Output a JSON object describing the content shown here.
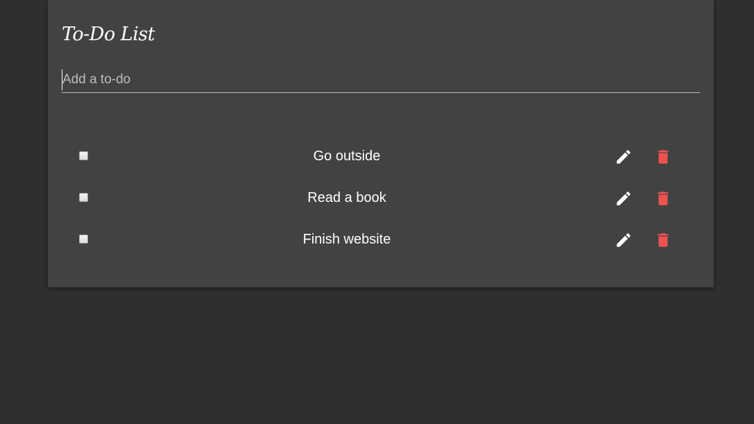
{
  "app": {
    "title": "To-Do List"
  },
  "new_todo": {
    "placeholder": "Add a to-do",
    "value": ""
  },
  "todos": [
    {
      "text": "Go outside",
      "checked": false
    },
    {
      "text": "Read a book",
      "checked": false
    },
    {
      "text": "Finish website",
      "checked": false
    }
  ],
  "icons": {
    "edit": "pencil-icon",
    "delete": "trash-icon"
  },
  "colors": {
    "page_background": "#2f2f2f",
    "card_background": "#424242",
    "delete_icon": "#ef5350",
    "edit_icon": "#ffffff"
  }
}
